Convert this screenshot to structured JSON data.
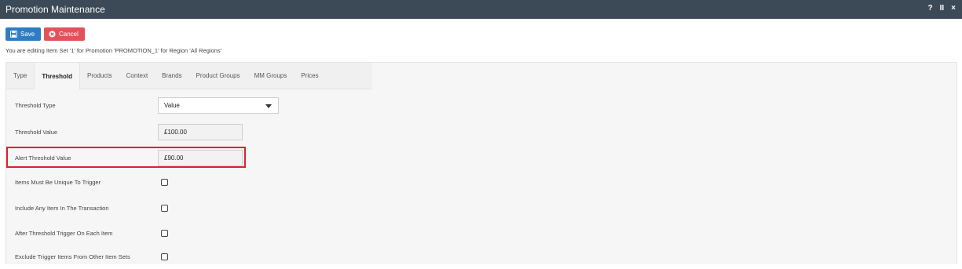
{
  "window": {
    "title": "Promotion Maintenance",
    "controls": [
      "?",
      "II",
      "×"
    ]
  },
  "toolbar": {
    "save_label": "Save",
    "cancel_label": "Cancel"
  },
  "info_text": "You are editing Item Set '1' for Promotion 'PROMOTION_1' for Region 'All Regions'",
  "tabs": [
    {
      "label": "Type"
    },
    {
      "label": "Threshold",
      "active": true
    },
    {
      "label": "Products"
    },
    {
      "label": "Context"
    },
    {
      "label": "Brands"
    },
    {
      "label": "Product Groups"
    },
    {
      "label": "MM Groups"
    },
    {
      "label": "Prices"
    }
  ],
  "form": {
    "threshold_type": {
      "label": "Threshold Type",
      "value": "Value"
    },
    "threshold_value": {
      "label": "Threshold Value",
      "value": "£100.00"
    },
    "alert_threshold_value": {
      "label": "Alert Threshold Value",
      "value": "£90.00"
    },
    "items_unique": {
      "label": "Items Must Be Unique To Trigger",
      "checked": false
    },
    "include_any_item": {
      "label": "Include Any Item In The Transaction",
      "checked": false
    },
    "after_threshold_trigger": {
      "label": "After Threshold Trigger On Each Item",
      "checked": false
    },
    "exclude_trigger_items": {
      "label": "Exclude Trigger Items From Other Item Sets",
      "checked": false
    }
  },
  "colors": {
    "titlebar": "#3c4a57",
    "save_button": "#2f7cc3",
    "cancel_button": "#e0535b",
    "highlight_border": "#e0202b"
  }
}
